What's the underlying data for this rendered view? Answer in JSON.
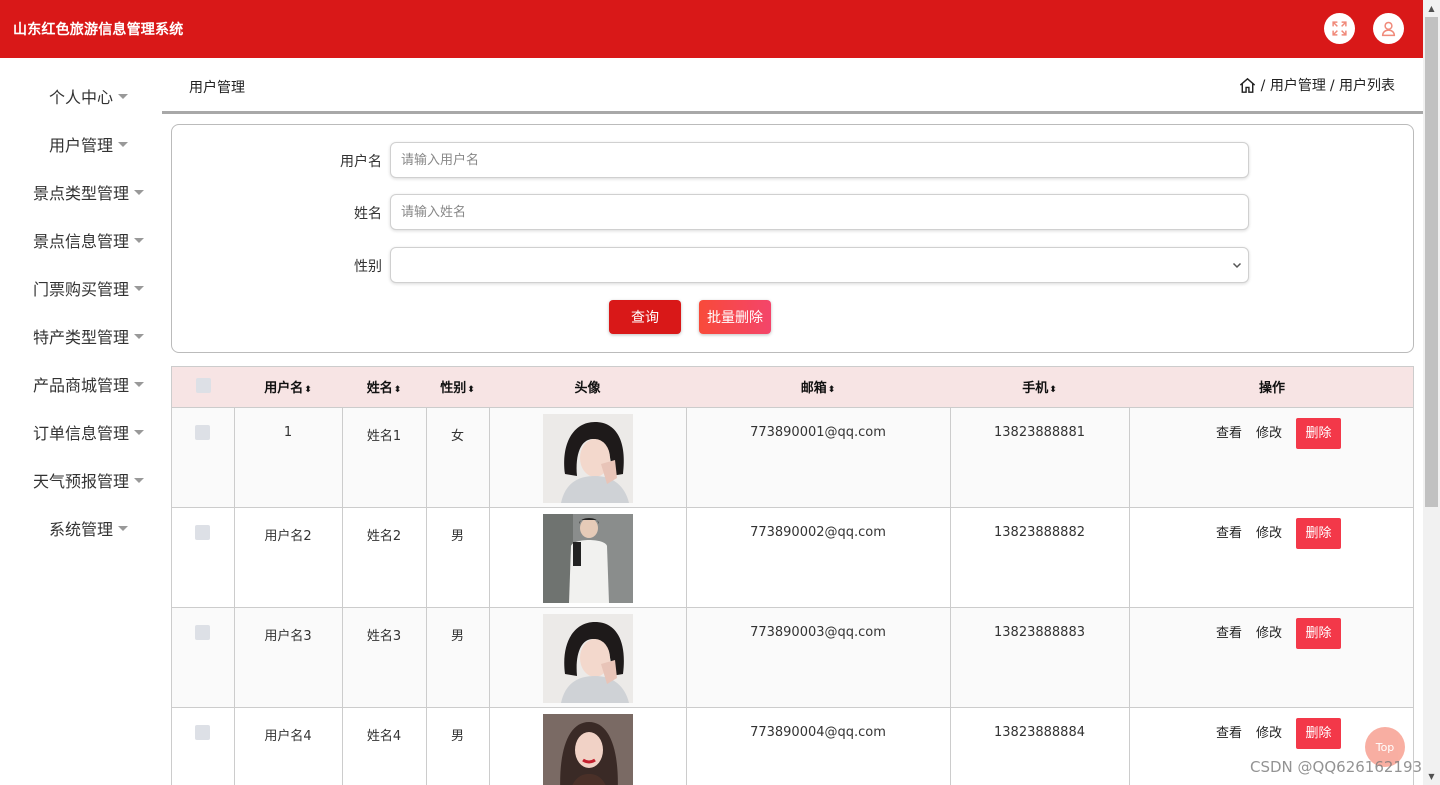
{
  "header": {
    "app_title": "山东红色旅游信息管理系统",
    "fullscreen_icon": "fullscreen-icon",
    "user_icon": "user-icon"
  },
  "sidebar": {
    "items": [
      {
        "label": "个人中心"
      },
      {
        "label": "用户管理"
      },
      {
        "label": "景点类型管理"
      },
      {
        "label": "景点信息管理"
      },
      {
        "label": "门票购买管理"
      },
      {
        "label": "特产类型管理"
      },
      {
        "label": "产品商城管理"
      },
      {
        "label": "订单信息管理"
      },
      {
        "label": "天气预报管理"
      },
      {
        "label": "系统管理"
      }
    ]
  },
  "page": {
    "title": "用户管理",
    "breadcrumb": [
      "/ 用户管理",
      "/ 用户列表"
    ]
  },
  "search": {
    "username_label": "用户名",
    "username_placeholder": "请输入用户名",
    "username_value": "",
    "name_label": "姓名",
    "name_placeholder": "请输入姓名",
    "name_value": "",
    "gender_label": "性别",
    "gender_value": "",
    "query_label": "查询",
    "batch_delete_label": "批量删除"
  },
  "table": {
    "headers": [
      "用户名",
      "姓名",
      "性别",
      "头像",
      "邮箱",
      "手机",
      "操作"
    ],
    "sort_glyph": "⬍",
    "rows": [
      {
        "username": "1",
        "name": "姓名1",
        "gender": "女",
        "email": "773890001@qq.com",
        "phone": "13823888881",
        "avatar": "avatar-female-1"
      },
      {
        "username": "用户名2",
        "name": "姓名2",
        "gender": "男",
        "email": "773890002@qq.com",
        "phone": "13823888882",
        "avatar": "avatar-male-1"
      },
      {
        "username": "用户名3",
        "name": "姓名3",
        "gender": "男",
        "email": "773890003@qq.com",
        "phone": "13823888883",
        "avatar": "avatar-female-1"
      },
      {
        "username": "用户名4",
        "name": "姓名4",
        "gender": "男",
        "email": "773890004@qq.com",
        "phone": "13823888884",
        "avatar": "avatar-female-2"
      }
    ],
    "actions": {
      "view": "查看",
      "edit": "修改",
      "delete": "删除"
    }
  },
  "misc": {
    "top_button": "Top",
    "watermark": "CSDN @QQ626162193"
  },
  "colors": {
    "brand": "#d91818",
    "delete": "#f33849",
    "header_row": "#f7e4e4"
  }
}
